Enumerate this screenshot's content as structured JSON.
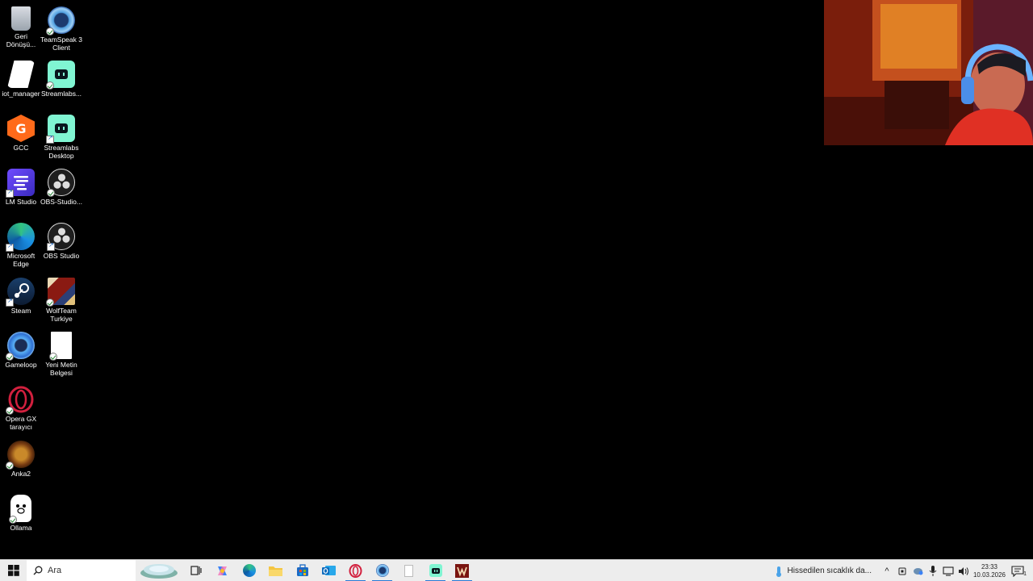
{
  "desktop": {
    "icons": [
      {
        "label": "Geri Dönüşü...",
        "name": "recycle-bin"
      },
      {
        "label": "TeamSpeak 3 Client",
        "name": "teamspeak"
      },
      {
        "label": "iot_manager",
        "name": "iot-manager"
      },
      {
        "label": "Streamlabs...",
        "name": "streamlabs-1"
      },
      {
        "label": "GCC",
        "name": "gcc"
      },
      {
        "label": "Streamlabs Desktop",
        "name": "streamlabs-desktop"
      },
      {
        "label": "LM Studio",
        "name": "lm-studio"
      },
      {
        "label": "OBS-Studio...",
        "name": "obs-studio-1"
      },
      {
        "label": "Microsoft Edge",
        "name": "microsoft-edge"
      },
      {
        "label": "OBS Studio",
        "name": "obs-studio"
      },
      {
        "label": "Steam",
        "name": "steam"
      },
      {
        "label": "WolfTeam Turkiye",
        "name": "wolfteam"
      },
      {
        "label": "Gameloop",
        "name": "gameloop"
      },
      {
        "label": "Yeni Metin Belgesi",
        "name": "yeni-metin-belgesi"
      },
      {
        "label": "Opera GX tarayıcı",
        "name": "opera-gx"
      },
      {
        "label": "Anka2",
        "name": "anka2"
      },
      {
        "label": "Ollama",
        "name": "ollama"
      }
    ]
  },
  "taskbar": {
    "search_placeholder": "Ara",
    "apps": [
      "widgets",
      "task-view",
      "copilot",
      "edge",
      "file-explorer",
      "store",
      "outlook",
      "opera-gx",
      "teamspeak",
      "notepad",
      "streamlabs",
      "wolfteam"
    ],
    "weather_text": "Hissedilen sıcaklık da...",
    "clock_time": "23:33",
    "clock_date": "10.03.2026",
    "notification_count": "1"
  },
  "colors": {
    "taskbar_bg": "#ededed",
    "accent": "#2b7bd6"
  }
}
